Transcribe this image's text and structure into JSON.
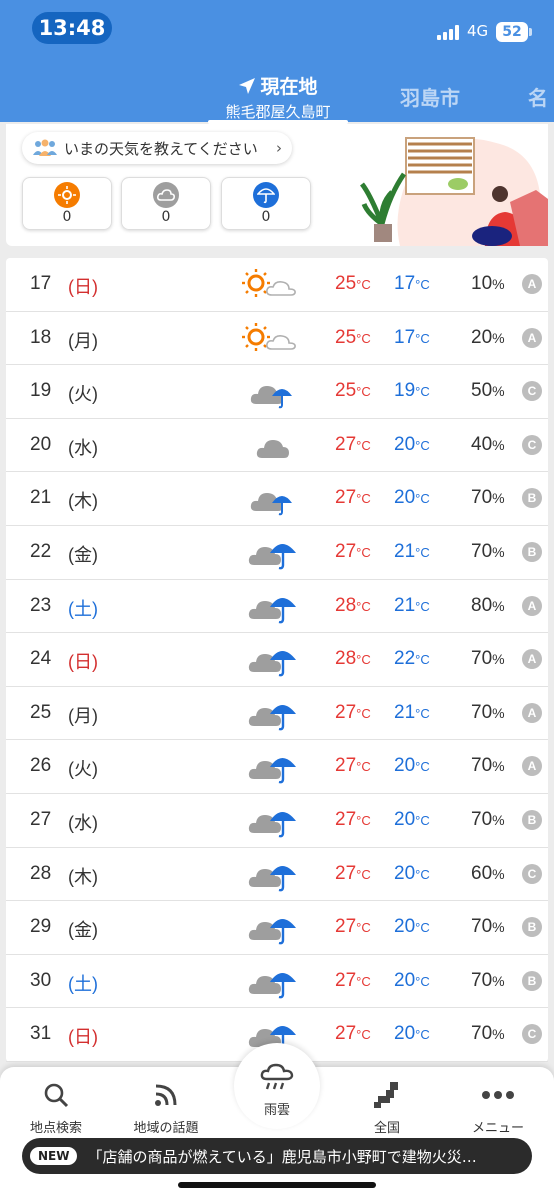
{
  "status": {
    "time": "13:48",
    "network": "4G",
    "battery": "52"
  },
  "header": {
    "current_tab_title": "現在地",
    "current_tab_location": "熊毛郡屋久島町",
    "other_tab": "羽島市",
    "edge_tab_partial": "名"
  },
  "report": {
    "prompt": "いまの天気を教えてください",
    "chevron": "›",
    "votes": [
      {
        "icon": "sunny-icon",
        "count": "0"
      },
      {
        "icon": "cloudy-icon",
        "count": "0"
      },
      {
        "icon": "rainy-icon",
        "count": "0"
      }
    ]
  },
  "forecast": {
    "temp_unit": "°C",
    "pct_unit": "%",
    "rows": [
      {
        "day": "17",
        "dow": "(日)",
        "dow_type": "sun",
        "weather": "sunny-cloudy",
        "hi": "25",
        "lo": "17",
        "pop": "10",
        "rank": "A"
      },
      {
        "day": "18",
        "dow": "(月)",
        "dow_type": "weekday",
        "weather": "sunny-cloudy",
        "hi": "25",
        "lo": "17",
        "pop": "20",
        "rank": "A"
      },
      {
        "day": "19",
        "dow": "(火)",
        "dow_type": "weekday",
        "weather": "cloudy-rain-small",
        "hi": "25",
        "lo": "19",
        "pop": "50",
        "rank": "C"
      },
      {
        "day": "20",
        "dow": "(水)",
        "dow_type": "weekday",
        "weather": "cloudy",
        "hi": "27",
        "lo": "20",
        "pop": "40",
        "rank": "C"
      },
      {
        "day": "21",
        "dow": "(木)",
        "dow_type": "weekday",
        "weather": "cloudy-rain-small",
        "hi": "27",
        "lo": "20",
        "pop": "70",
        "rank": "B"
      },
      {
        "day": "22",
        "dow": "(金)",
        "dow_type": "weekday",
        "weather": "cloudy-rain",
        "hi": "27",
        "lo": "21",
        "pop": "70",
        "rank": "B"
      },
      {
        "day": "23",
        "dow": "(土)",
        "dow_type": "sat",
        "weather": "cloudy-rain",
        "hi": "28",
        "lo": "21",
        "pop": "80",
        "rank": "A"
      },
      {
        "day": "24",
        "dow": "(日)",
        "dow_type": "sun",
        "weather": "cloudy-rain",
        "hi": "28",
        "lo": "22",
        "pop": "70",
        "rank": "A"
      },
      {
        "day": "25",
        "dow": "(月)",
        "dow_type": "weekday",
        "weather": "cloudy-rain",
        "hi": "27",
        "lo": "21",
        "pop": "70",
        "rank": "A"
      },
      {
        "day": "26",
        "dow": "(火)",
        "dow_type": "weekday",
        "weather": "cloudy-rain",
        "hi": "27",
        "lo": "20",
        "pop": "70",
        "rank": "A"
      },
      {
        "day": "27",
        "dow": "(水)",
        "dow_type": "weekday",
        "weather": "cloudy-rain",
        "hi": "27",
        "lo": "20",
        "pop": "70",
        "rank": "B"
      },
      {
        "day": "28",
        "dow": "(木)",
        "dow_type": "weekday",
        "weather": "cloudy-rain",
        "hi": "27",
        "lo": "20",
        "pop": "60",
        "rank": "C"
      },
      {
        "day": "29",
        "dow": "(金)",
        "dow_type": "weekday",
        "weather": "cloudy-rain",
        "hi": "27",
        "lo": "20",
        "pop": "70",
        "rank": "B"
      },
      {
        "day": "30",
        "dow": "(土)",
        "dow_type": "sat",
        "weather": "cloudy-rain",
        "hi": "27",
        "lo": "20",
        "pop": "70",
        "rank": "B"
      },
      {
        "day": "31",
        "dow": "(日)",
        "dow_type": "sun",
        "weather": "cloudy-rain",
        "hi": "27",
        "lo": "20",
        "pop": "70",
        "rank": "C"
      }
    ]
  },
  "nav": {
    "search": "地点検索",
    "topics": "地域の話題",
    "rain": "雨雲",
    "nation": "全国",
    "menu": "メニュー"
  },
  "news": {
    "badge": "NEW",
    "text": "「店舗の商品が燃えている」鹿児島市小野町で建物火災…"
  },
  "colors": {
    "header": "#4a90e2",
    "hot": "#e53935",
    "cold": "#1e6fd9",
    "sun": "#f57c00"
  }
}
